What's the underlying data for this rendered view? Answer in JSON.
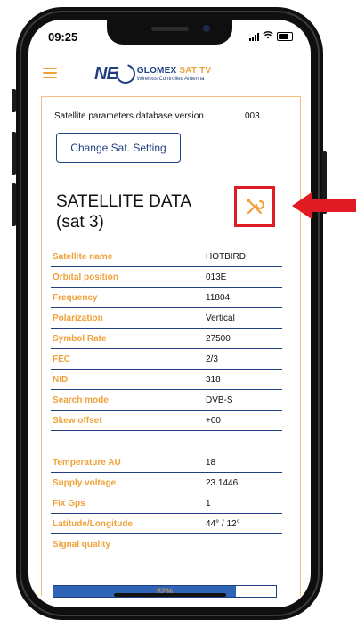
{
  "status_bar": {
    "time": "09:25"
  },
  "header": {
    "logo_neo": "NE",
    "logo_brand_glomex": "GLOMEX ",
    "logo_brand_sattv": "SAT TV",
    "logo_subtitle": "Wireless Controlled Antenna"
  },
  "database": {
    "label": "Satellite parameters database version",
    "version": "003"
  },
  "change_button": {
    "label": "Change Sat. Setting"
  },
  "satellite_title": {
    "line1": "SATELLITE DATA",
    "line2": "(sat 3)"
  },
  "satellite_rows": [
    {
      "label": "Satellite name",
      "value": "HOTBIRD"
    },
    {
      "label": "Orbital position",
      "value": "013E"
    },
    {
      "label": "Frequency",
      "value": "11804"
    },
    {
      "label": "Polarization",
      "value": "Vertical"
    },
    {
      "label": "Symbol Rate",
      "value": "27500"
    },
    {
      "label": "FEC",
      "value": "2/3"
    },
    {
      "label": "NID",
      "value": "318"
    },
    {
      "label": "Search mode",
      "value": "DVB-S"
    },
    {
      "label": "Skew offset",
      "value": "+00"
    }
  ],
  "device_rows": [
    {
      "label": "Temperature AU",
      "value": "18"
    },
    {
      "label": "Supply voltage",
      "value": "23.1446"
    },
    {
      "label": "Fix Gps",
      "value": "1"
    },
    {
      "label": "Latitude/Longitude",
      "value": "44° / 12°"
    }
  ],
  "signal_quality": {
    "label": "Signal quality",
    "percent_text": "82%",
    "level": 0.82
  },
  "colors": {
    "accent_orange": "#f0a23a",
    "navy": "#1f3f80",
    "highlight_red": "#e01b24",
    "bar_blue": "#2f63b5"
  },
  "icons": {
    "menu": "hamburger-icon",
    "tools": "wrench-screwdriver-icon",
    "arrow": "red-arrow-icon"
  }
}
